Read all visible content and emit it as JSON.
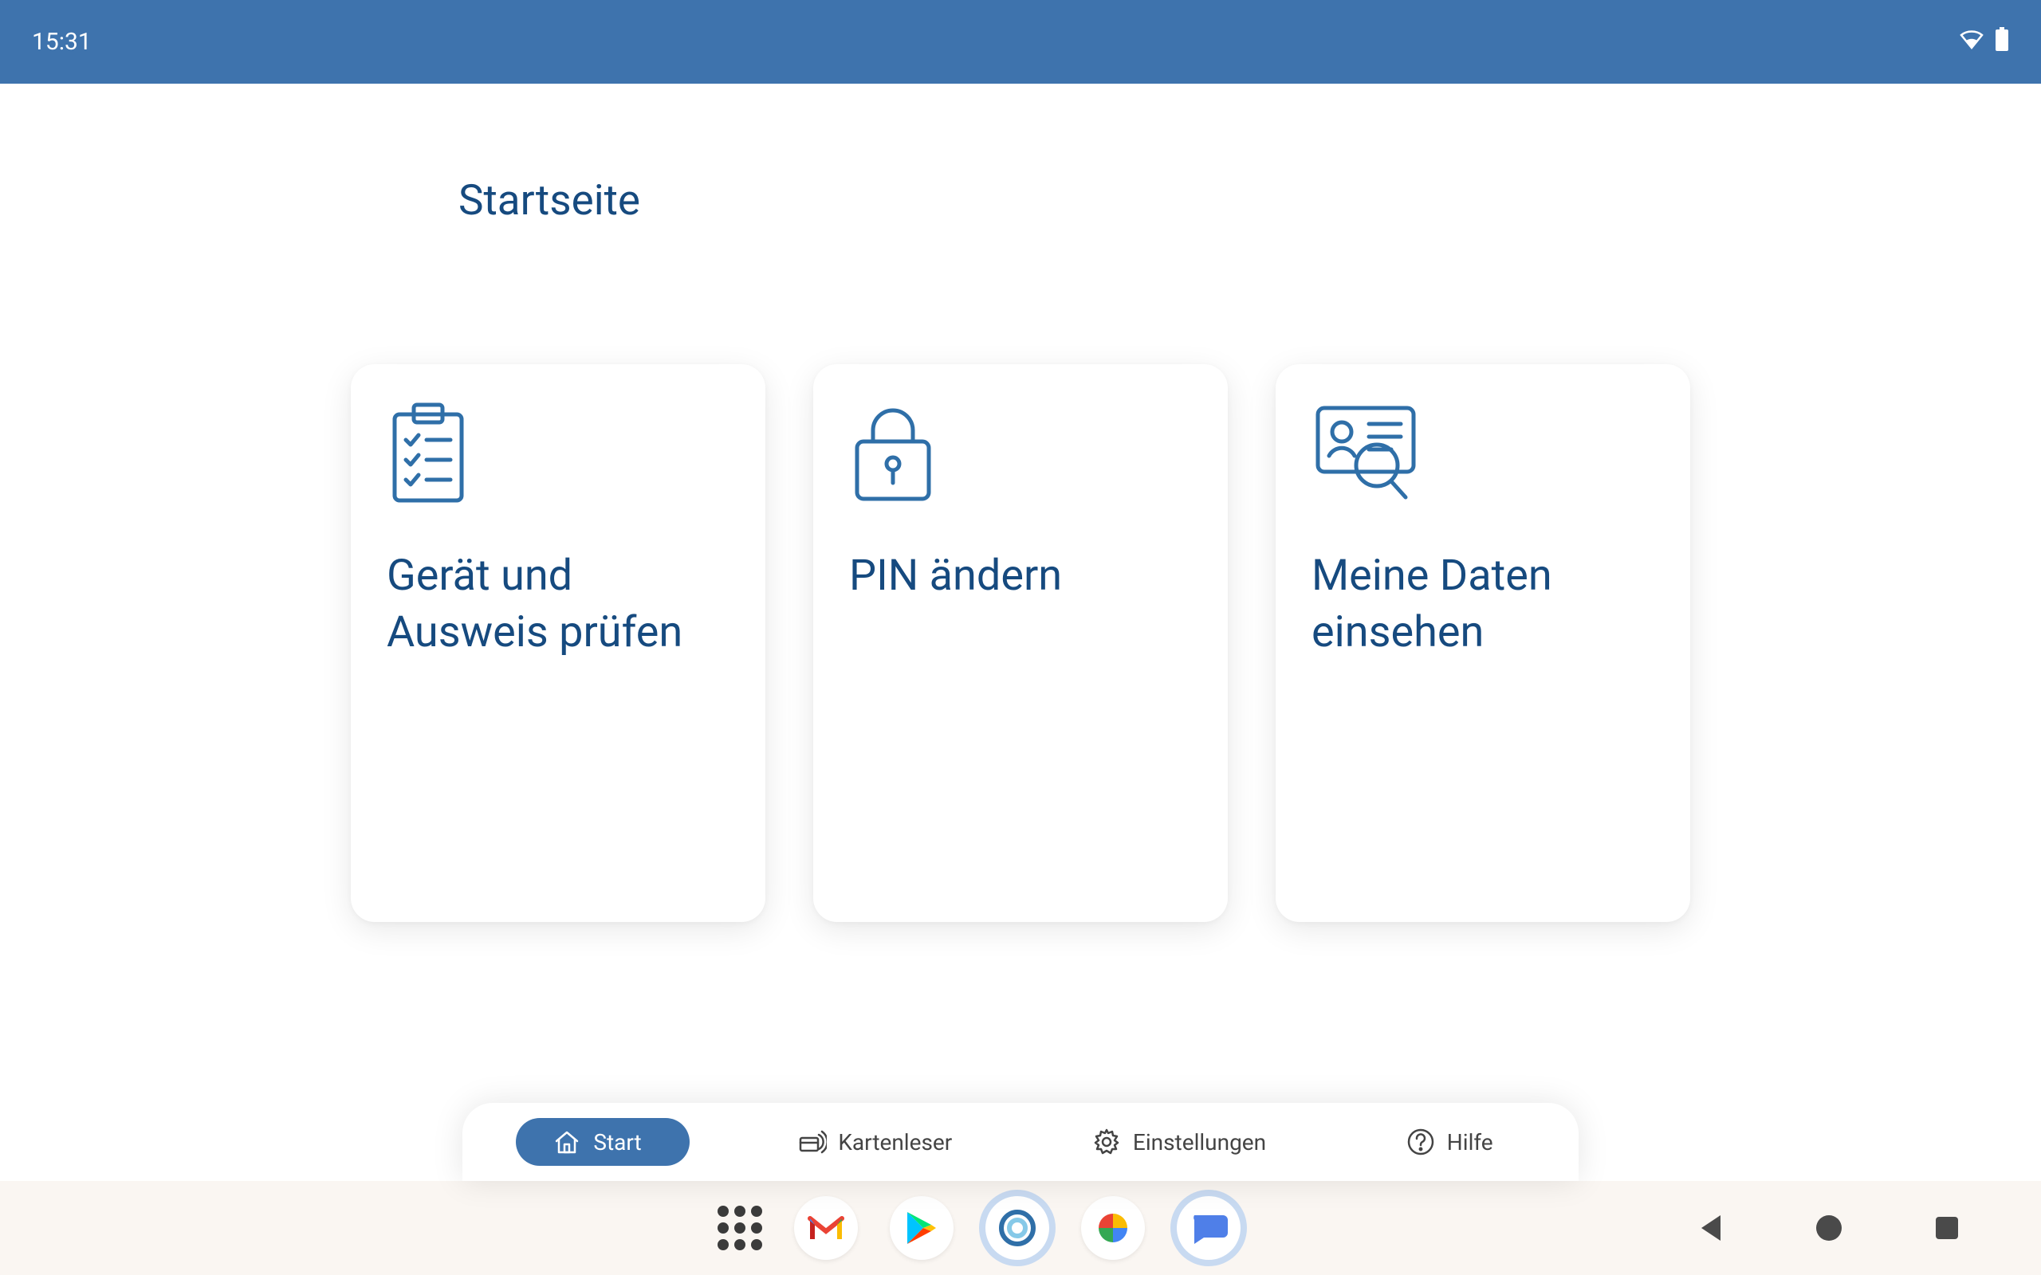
{
  "status": {
    "time": "15:31"
  },
  "page": {
    "title": "Startseite"
  },
  "cards": [
    {
      "title": "Gerät und Ausweis prüfen"
    },
    {
      "title": "PIN ändern"
    },
    {
      "title": "Meine Daten einsehen"
    }
  ],
  "nav": [
    {
      "label": "Start"
    },
    {
      "label": "Kartenleser"
    },
    {
      "label": "Einstellungen"
    },
    {
      "label": "Hilfe"
    }
  ]
}
